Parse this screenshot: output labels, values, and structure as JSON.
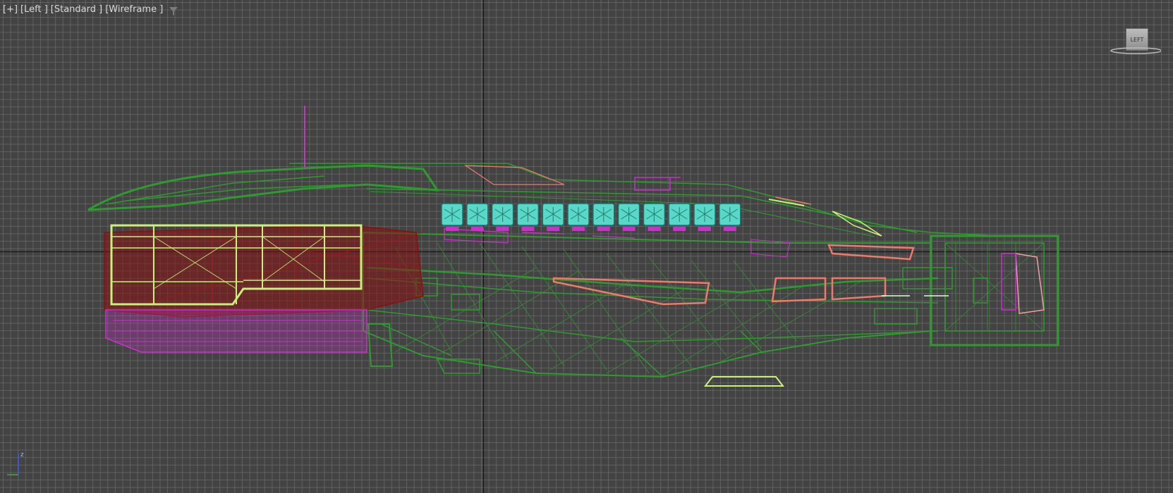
{
  "viewport": {
    "label_parts": [
      "[+]",
      "[Left ]",
      "[Standard ]",
      "[Wireframe ]"
    ],
    "filter_icon": "funnel-icon"
  },
  "viewcube": {
    "face_label": "LEFT",
    "icon": "viewcube-icon"
  },
  "axis_tripod": {
    "axis_label": "z"
  },
  "colors": {
    "background": "#434343",
    "grid": "#787878",
    "hull_green": "#2f9a2f",
    "magenta": "#c832c8",
    "dark_red": "#8a1010",
    "lime": "#c8f07a",
    "cyan": "#57d8c8",
    "salmon": "#f07a6a"
  }
}
